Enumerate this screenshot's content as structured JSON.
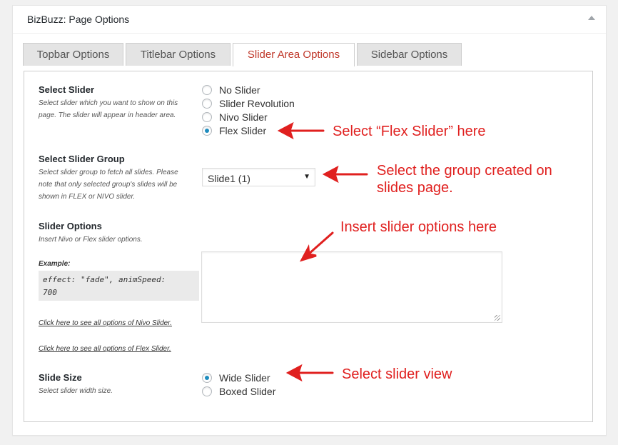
{
  "metabox": {
    "title": "BizBuzz: Page Options"
  },
  "tabs": [
    {
      "label": "Topbar Options",
      "active": false
    },
    {
      "label": "Titlebar Options",
      "active": false
    },
    {
      "label": "Slider Area Options",
      "active": true
    },
    {
      "label": "Sidebar Options",
      "active": false
    }
  ],
  "select_slider": {
    "label": "Select Slider",
    "description_lines": [
      "Select slider which you want to show on this",
      "page. The slider will appear in header area."
    ],
    "options": [
      {
        "label": "No Slider",
        "checked": false
      },
      {
        "label": "Slider Revolution",
        "checked": false
      },
      {
        "label": "Nivo Slider",
        "checked": false
      },
      {
        "label": "Flex Slider",
        "checked": true
      }
    ]
  },
  "slider_group": {
    "label": "Select Slider Group",
    "description_lines": [
      "Select slider group to fetch all slides. Please",
      "note that only selected group's slides will be",
      "shown in FLEX or NIVO slider."
    ],
    "selected_value": "Slide1 (1)"
  },
  "slider_options": {
    "label": "Slider Options",
    "description": "Insert Nivo or Flex slider options.",
    "example_label": "Example:",
    "example_lines": [
      "effect: \"fade\", animSpeed:",
      "700"
    ],
    "textarea_value": "",
    "nivo_link": "Click here to see all options of Nivo Slider.",
    "flex_link": "Click here to see all options of Flex Slider."
  },
  "slide_size": {
    "label": "Slide Size",
    "description": "Select slider width size.",
    "options": [
      {
        "label": "Wide Slider",
        "checked": true
      },
      {
        "label": "Boxed Slider",
        "checked": false
      }
    ]
  },
  "annotations": {
    "flex": "Select “Flex Slider” here",
    "group_lines": [
      "Select the group created on",
      "slides page."
    ],
    "options": "Insert slider options here",
    "view": "Select slider view"
  },
  "colors": {
    "annotation": "#e0201f",
    "active_tab_text": "#c0392b",
    "radio_checked": "#1e8cbe"
  }
}
